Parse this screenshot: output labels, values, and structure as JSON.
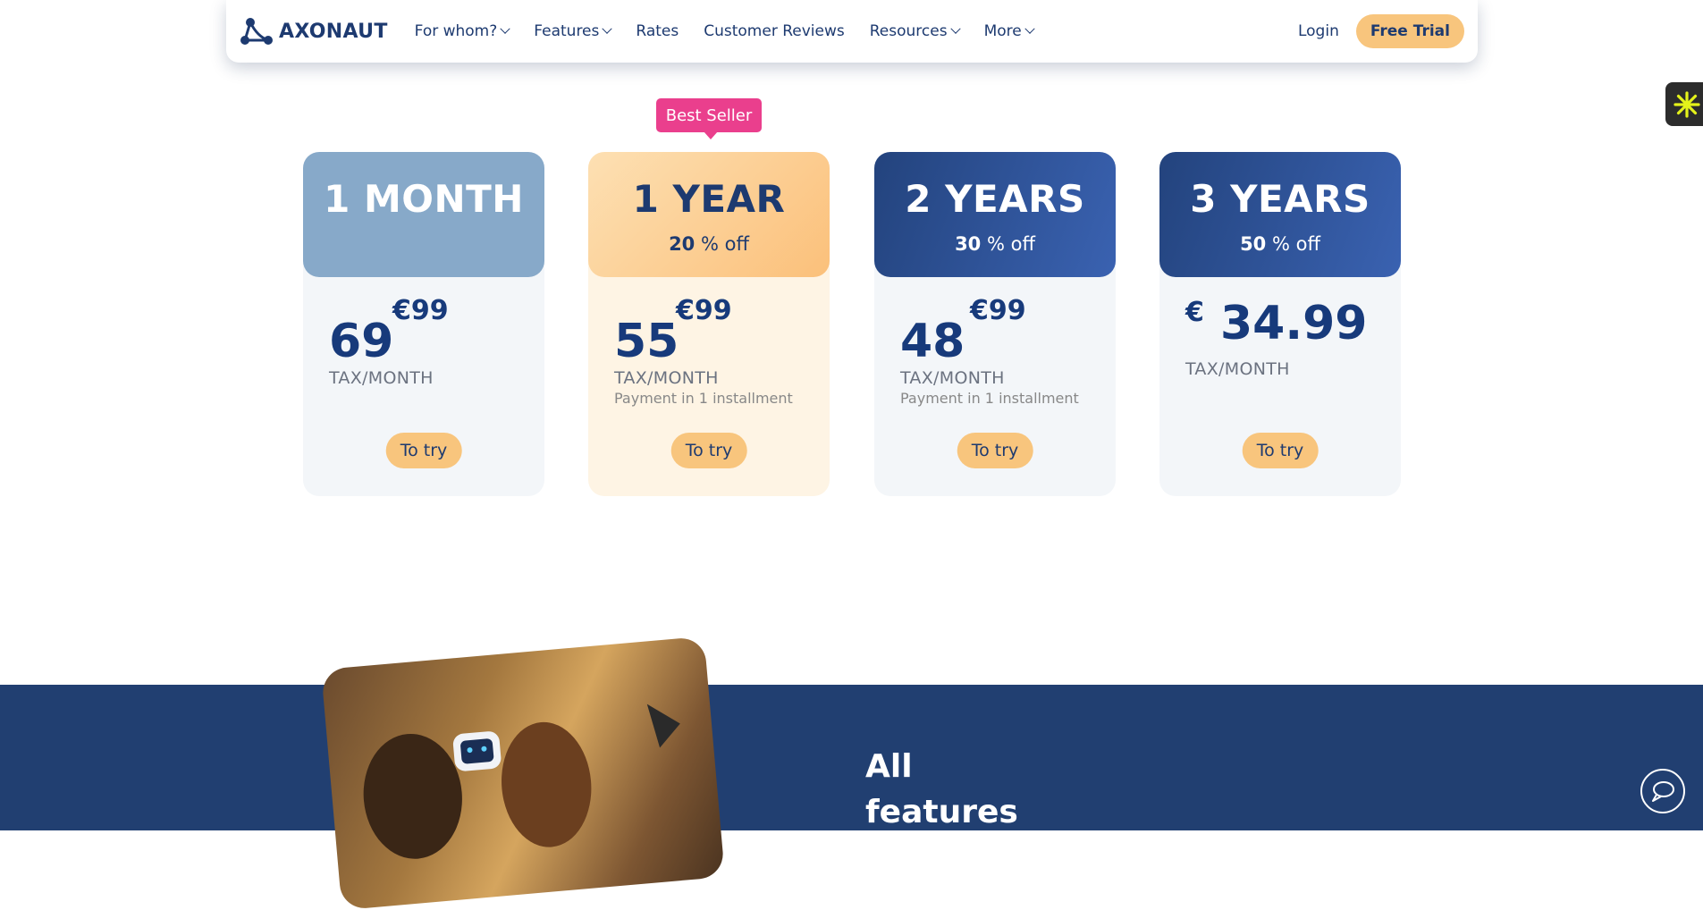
{
  "nav": {
    "brand": "AXONAUT",
    "items": [
      {
        "label": "For whom?",
        "dropdown": true
      },
      {
        "label": "Features",
        "dropdown": true
      },
      {
        "label": "Rates",
        "dropdown": false
      },
      {
        "label": "Customer Reviews",
        "dropdown": false
      },
      {
        "label": "Resources",
        "dropdown": true
      },
      {
        "label": "More",
        "dropdown": true
      }
    ],
    "login": "Login",
    "trial": "Free Trial"
  },
  "badge": "Best Seller",
  "plans": [
    {
      "title": "1 MONTH",
      "discount_value": "",
      "discount_text": "",
      "price": "69",
      "old_price": "€99",
      "tax": "TAX/MONTH",
      "installment": "",
      "cta": "To try"
    },
    {
      "title": "1 YEAR",
      "discount_value": "20",
      "discount_text": " % off",
      "price": "55",
      "old_price": "€99",
      "tax": "TAX/MONTH",
      "installment": "Payment in 1 installment",
      "cta": "To try"
    },
    {
      "title": "2 YEARS",
      "discount_value": "30",
      "discount_text": " % off",
      "price": "48",
      "old_price": "€99",
      "tax": "TAX/MONTH",
      "installment": "Payment in 1 installment",
      "cta": "To try"
    },
    {
      "title": "3 YEARS",
      "discount_value": "50",
      "discount_text": " % off",
      "price": "34.99",
      "currency": "€",
      "tax": "TAX/MONTH",
      "cta": "To try"
    }
  ],
  "features": {
    "line1": "All",
    "line2": "features"
  },
  "colors": {
    "navy": "#1d3a70",
    "accent": "#f8c57d",
    "badge": "#ea3f8d",
    "band": "#213f71"
  },
  "icons": {
    "logo": "axonaut-logo-icon",
    "widget": "asterisk-widget-icon",
    "chat": "chat-bubble-icon"
  }
}
